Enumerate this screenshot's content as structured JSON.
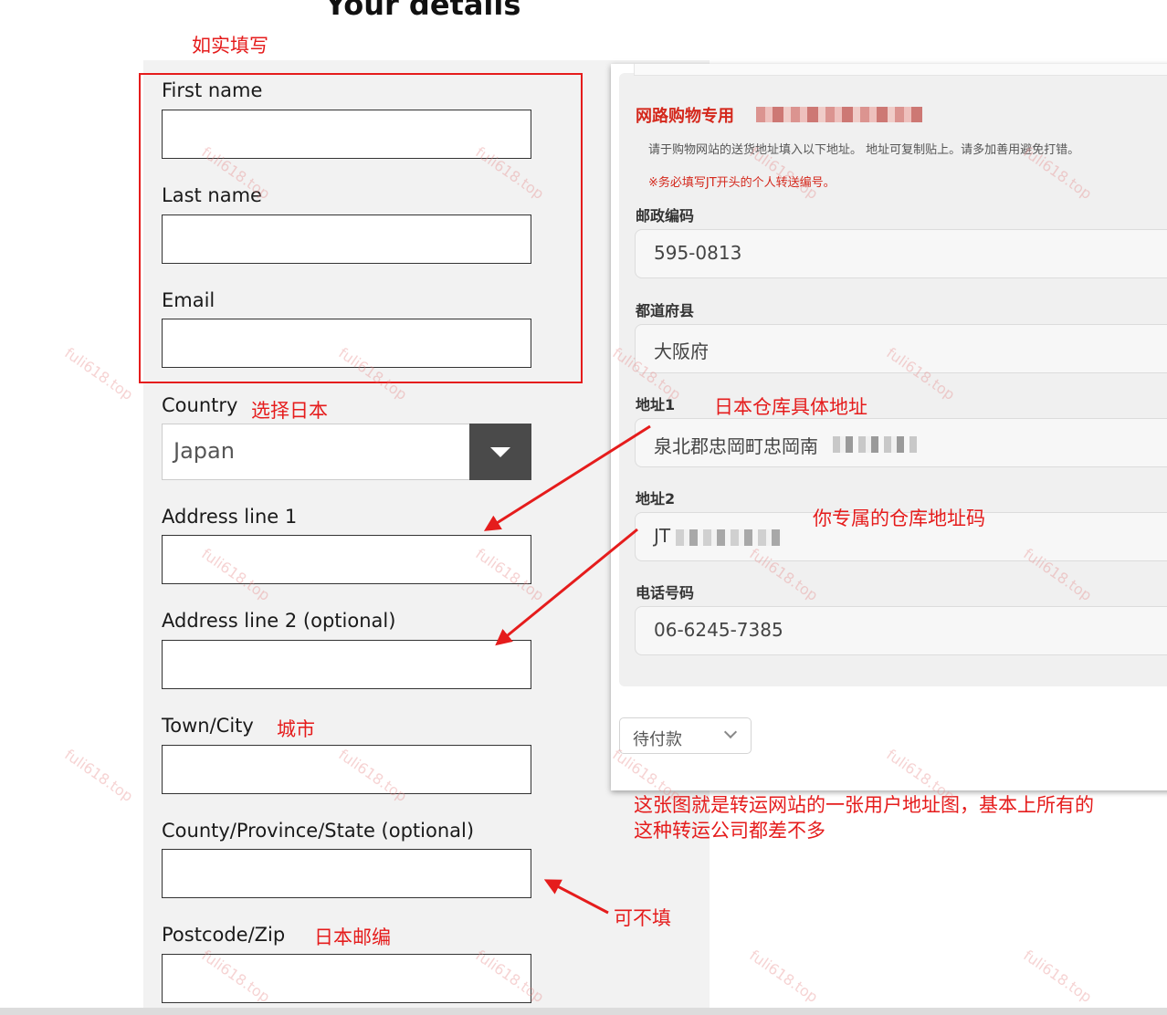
{
  "page_title": "Your details",
  "form": {
    "first_name_label": "First name",
    "last_name_label": "Last name",
    "email_label": "Email",
    "country_label": "Country",
    "country_value": "Japan",
    "address1_label": "Address line 1",
    "address2_label": "Address line 2 (optional)",
    "town_label": "Town/City",
    "county_label": "County/Province/State (optional)",
    "postcode_label": "Postcode/Zip"
  },
  "annotations": {
    "fill_truthfully": "如实填写",
    "select_japan": "选择日本",
    "city": "城市",
    "japan_postcode": "日本邮编",
    "warehouse_address": "日本仓库具体地址",
    "warehouse_code": "你专属的仓库地址码",
    "optional": "可不填",
    "explanation_line1": "这张图就是转运网站的一张用户地址图，基本上所有的",
    "explanation_line2": "这种转运公司都差不多"
  },
  "address_panel": {
    "heading": "网路购物专用",
    "note": "请于购物网站的送货地址填入以下地址。 地址可复制贴上。请多加善用避免打错。",
    "warning": "※务必填写JT开头的个人转送编号。",
    "postal_label": "邮政编码",
    "postal_value": "595-0813",
    "prefecture_label": "都道府县",
    "prefecture_value": "大阪府",
    "address1_label": "地址1",
    "address1_value": "泉北郡忠岡町忠岡南",
    "address2_label": "地址2",
    "address2_value": "JT",
    "phone_label": "电话号码",
    "phone_value": "06-6245-7385",
    "status_value": "待付款"
  },
  "watermark": "fuli618.top",
  "colors": {
    "annotation_red": "#e51c1c",
    "heading_red": "#d4281c"
  }
}
